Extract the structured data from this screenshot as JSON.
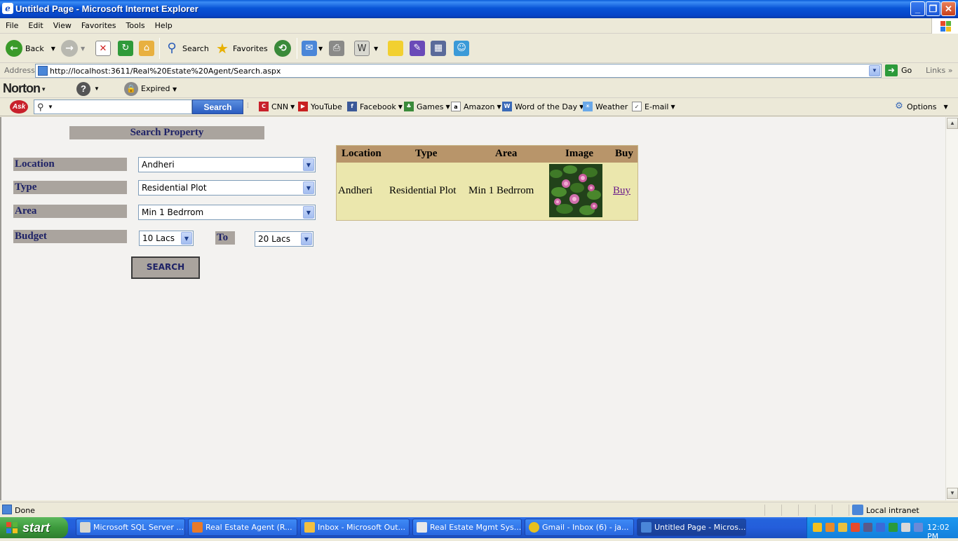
{
  "window": {
    "title": "Untitled Page - Microsoft Internet Explorer"
  },
  "menubar": [
    "File",
    "Edit",
    "View",
    "Favorites",
    "Tools",
    "Help"
  ],
  "toolbar": {
    "back": "Back",
    "search": "Search",
    "favorites": "Favorites"
  },
  "address": {
    "label": "Address",
    "url": "http://localhost:3611/Real%20Estate%20Agent/Search.aspx",
    "go": "Go",
    "links": "Links"
  },
  "norton": {
    "logo": "Norton",
    "expired": "Expired"
  },
  "askbar": {
    "logo": "Ask",
    "search_button": "Search",
    "links": [
      "CNN",
      "YouTube",
      "Facebook",
      "Games",
      "Amazon",
      "Word of the Day",
      "Weather",
      "E-mail"
    ],
    "options": "Options"
  },
  "form": {
    "heading": "Search Property",
    "location_label": "Location",
    "location_value": "Andheri",
    "type_label": "Type",
    "type_value": "Residential Plot",
    "area_label": "Area",
    "area_value": "Min 1 Bedrrom",
    "budget_label": "Budget",
    "budget_from": "10 Lacs",
    "to_label": "To",
    "budget_to": "20 Lacs",
    "search_button": "SEARCH"
  },
  "results": {
    "headers": [
      "Location",
      "Type",
      "Area",
      "Image",
      "Buy"
    ],
    "rows": [
      {
        "location": "Andheri",
        "type": "Residential Plot",
        "area": "Min 1 Bedrrom",
        "buy": "Buy"
      }
    ]
  },
  "statusbar": {
    "text": "Done",
    "zone": "Local intranet"
  },
  "taskbar": {
    "start": "start",
    "tasks": [
      "Microsoft SQL Server ...",
      "Real Estate Agent (R...",
      "Inbox - Microsoft Out...",
      "Real Estate Mgmt Sys...",
      "Gmail - Inbox (6) - ja...",
      "Untitled Page - Micros..."
    ],
    "clock": "12:02 PM"
  }
}
